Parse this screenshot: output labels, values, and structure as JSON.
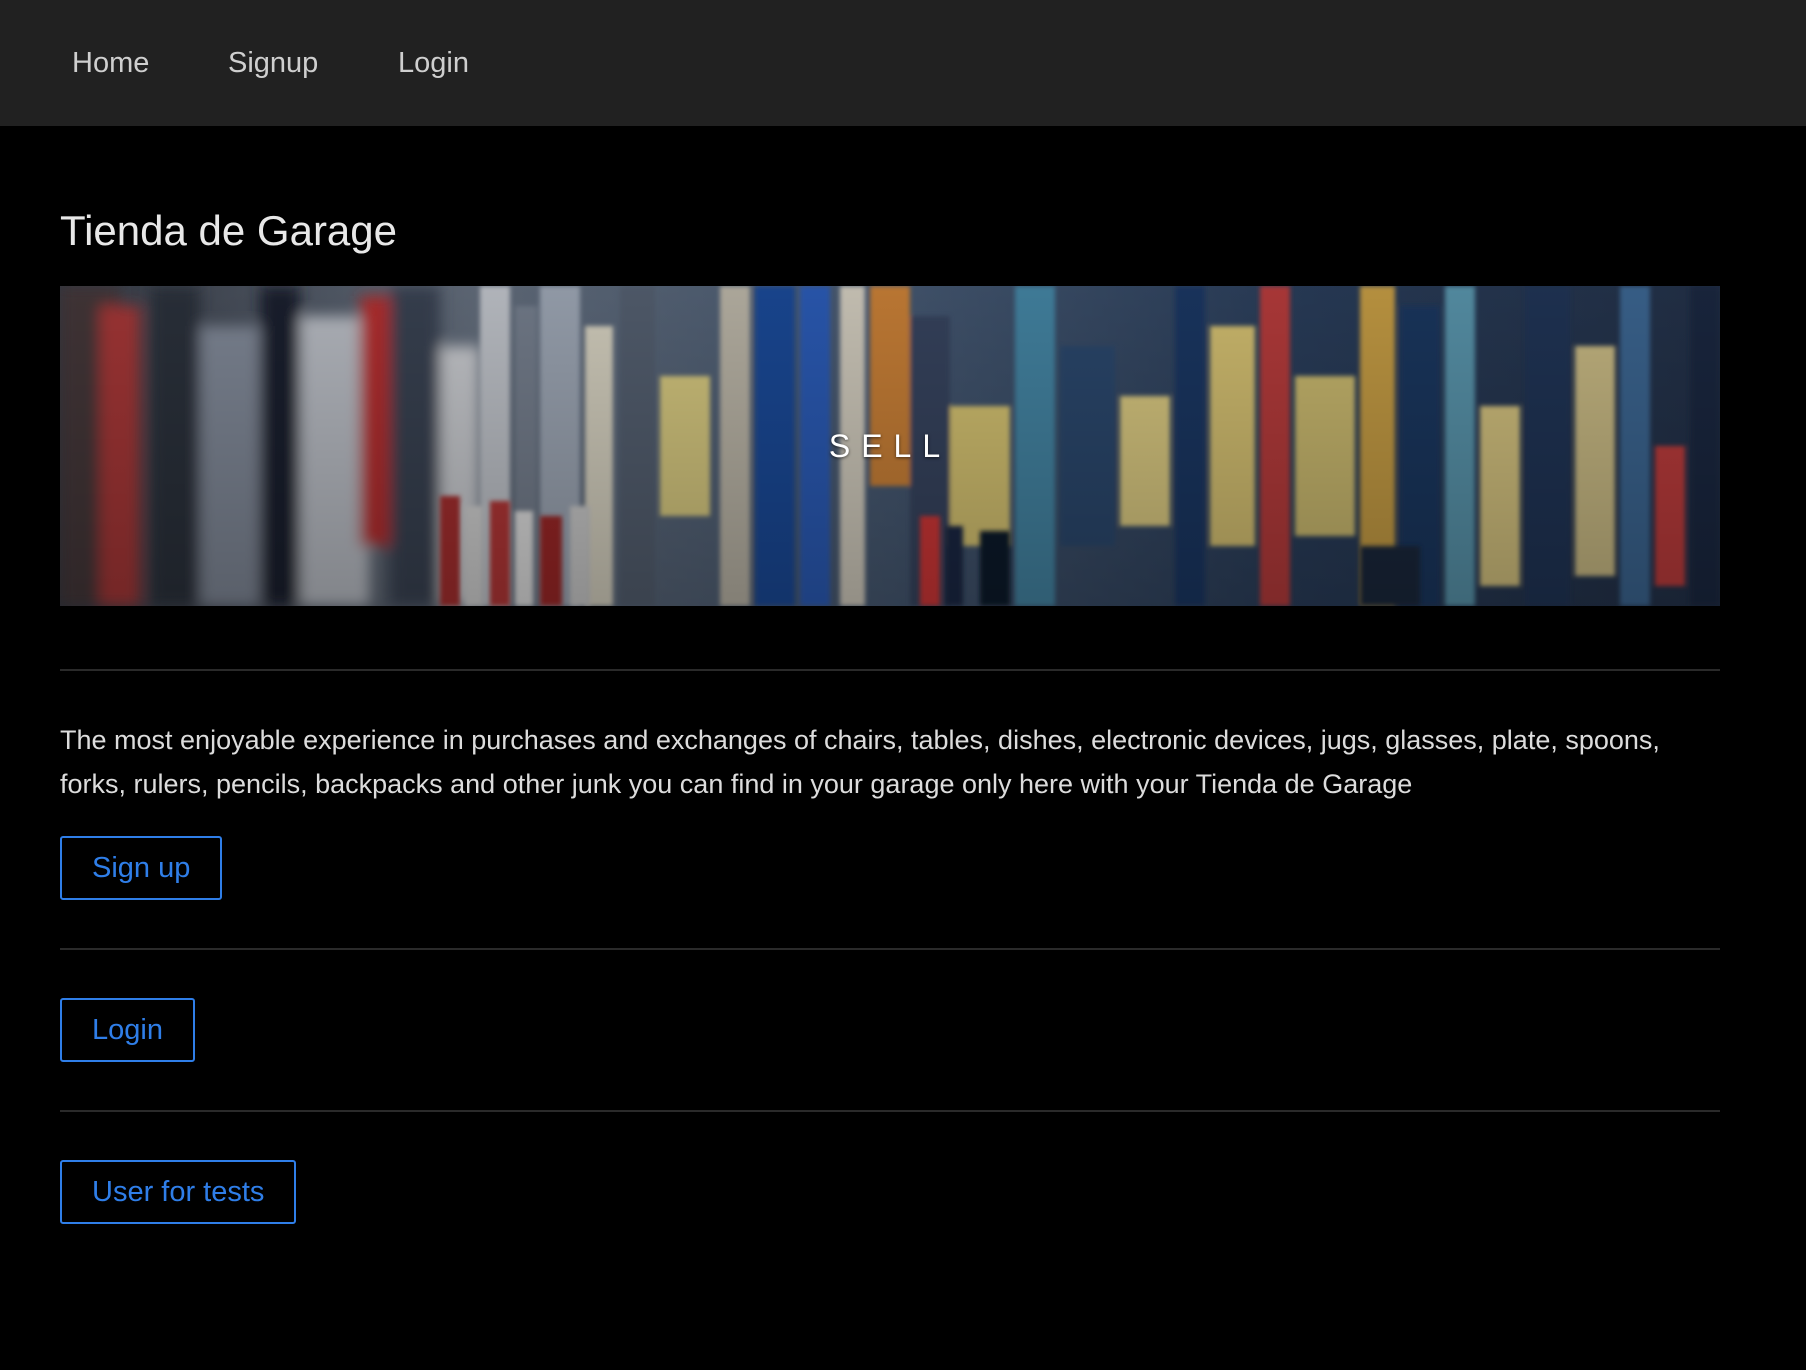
{
  "nav": {
    "items": [
      {
        "label": "Home"
      },
      {
        "label": "Signup"
      },
      {
        "label": "Login"
      }
    ]
  },
  "page": {
    "title": "Tienda de Garage",
    "banner_text": "SELL",
    "description": "The most enjoyable experience in purchases and exchanges of chairs, tables, dishes, electronic devices, jugs, glasses, plate, spoons, forks, rulers, pencils, backpacks and other junk you can find in your garage only here with your Tienda de Garage"
  },
  "actions": {
    "signup_label": "Sign up",
    "login_label": "Login",
    "test_user_label": "User for tests"
  },
  "colors": {
    "background": "#000000",
    "navbar": "#212121",
    "accent": "#2f7ee8",
    "text": "#dcdcdc"
  }
}
